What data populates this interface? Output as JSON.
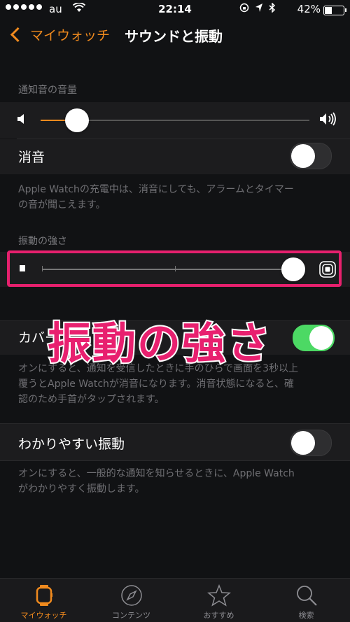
{
  "status": {
    "carrier": "au",
    "time": "22:14",
    "battery": "42%",
    "battery_level": 0.42
  },
  "nav": {
    "back_label": "マイウォッチ",
    "title": "サウンドと振動"
  },
  "sections": {
    "alert_volume": {
      "header": "通知音の音量",
      "slider_value": 0.1
    },
    "mute": {
      "label": "消音",
      "on": false,
      "description_line1": "Apple Watchの充電中は、消音にしても、アラームとタイマー",
      "description_line2": "の音が聞こえます。"
    },
    "haptic_strength": {
      "header": "振動の強さ",
      "slider_value": 1.0
    },
    "cover_to_mute": {
      "label": "カバー",
      "on": true,
      "description_line1": "オンにすると、通知を受信したときに手のひらで画面を3秒以上",
      "description_line2": "覆うとApple Watchが消音になります。消音状態になると、確",
      "description_line3": "認のため手首がタップされます。"
    },
    "prominent_haptic": {
      "label": "わかりやすい振動",
      "on": false,
      "description_line1": "オンにすると、一般的な通知を知らせるときに、Apple Watch",
      "description_line2": "がわかりやすく振動します。"
    }
  },
  "overlay": {
    "caption": "振動の強さ"
  },
  "tabs": [
    {
      "label": "マイウォッチ",
      "active": true
    },
    {
      "label": "コンテンツ",
      "active": false
    },
    {
      "label": "おすすめ",
      "active": false
    },
    {
      "label": "検索",
      "active": false
    }
  ],
  "colors": {
    "accent": "#f08a1e",
    "highlight": "#e6206d",
    "toggle_on": "#4cd964"
  }
}
